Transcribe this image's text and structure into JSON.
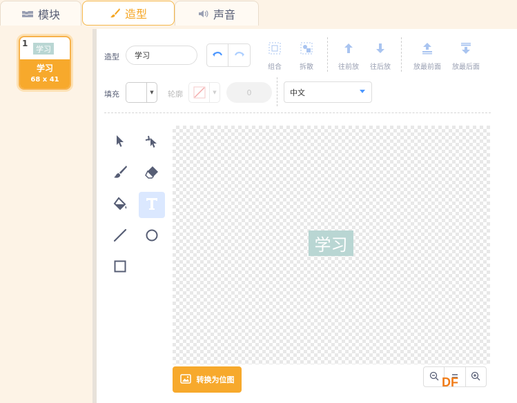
{
  "tabs": [
    {
      "label": "模块",
      "icon": "blocks-icon"
    },
    {
      "label": "造型",
      "icon": "brush-icon",
      "active": true
    },
    {
      "label": "声音",
      "icon": "speaker-icon"
    }
  ],
  "costumes": [
    {
      "number": "1",
      "thumb_text": "学习",
      "name": "学习",
      "size": "68 x 41"
    }
  ],
  "toolbar": {
    "costume_label": "造型",
    "costume_name": "学习",
    "undo_icon": "undo-icon",
    "redo_icon": "redo-icon",
    "group": "组合",
    "ungroup": "拆散",
    "forward": "往前放",
    "backward": "往后放",
    "front": "放最前面",
    "back": "放最后面",
    "fill_label": "填充",
    "outline_label": "轮廓",
    "outline_width": "0",
    "font": "中文"
  },
  "canvas": {
    "text": "学习",
    "text_color": "#ffffff",
    "text_bg": "#b9d6d3"
  },
  "convert_button": "转换为位图",
  "watermark": "DF",
  "colors": {
    "accent": "#f7a92c",
    "selected_tool": "#dbe8ff",
    "blue": "#4c97ff"
  }
}
